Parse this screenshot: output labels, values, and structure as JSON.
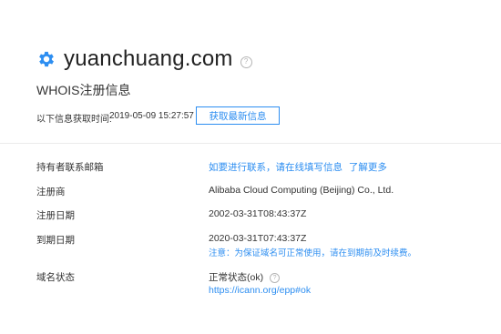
{
  "header": {
    "domain": "yuanchuang.com",
    "help_glyph": "?",
    "icon": "gear-icon",
    "accent_color": "#2d8ef1"
  },
  "section_title": "WHOIS注册信息",
  "fetch": {
    "label": "以下信息获取时间:",
    "time": "2019-05-09 15:27:57",
    "refresh_button": "获取最新信息"
  },
  "rows": {
    "registrant": {
      "label": "持有者联系邮箱",
      "link_text": "如要进行联系，请在线填写信息",
      "more_link": "了解更多"
    },
    "registrar": {
      "label": "注册商",
      "value": "Alibaba Cloud Computing (Beijing) Co., Ltd."
    },
    "created": {
      "label": "注册日期",
      "value": "2002-03-31T08:43:37Z"
    },
    "expires": {
      "label": "到期日期",
      "value": "2020-03-31T07:43:37Z",
      "note": "注意：为保证域名可正常使用，请在到期前及时续费。"
    },
    "status": {
      "label": "域名状态",
      "value": "正常状态(ok)",
      "help_glyph": "?",
      "link": "https://icann.org/epp#ok"
    }
  }
}
